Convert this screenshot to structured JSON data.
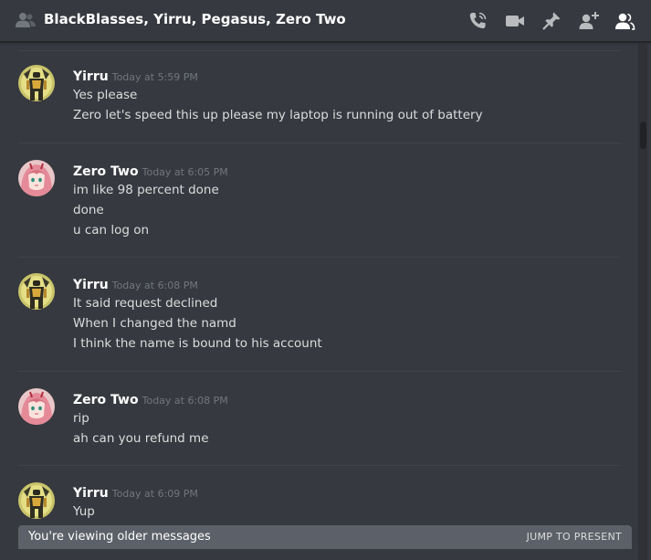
{
  "header": {
    "title": "BlackBlasses, Yirru, Pegasus, Zero Two",
    "icons": [
      "group-dm-icon",
      "call-icon",
      "video-icon",
      "pin-icon",
      "add-friend-icon",
      "member-list-icon"
    ]
  },
  "messages": [
    {
      "author": "Yirru",
      "timestamp": "Today at 5:59 PM",
      "avatar": "yellow-armored-figure",
      "lines": [
        "Yes please",
        "Zero let's speed this up please my laptop is running out of battery"
      ]
    },
    {
      "author": "Zero Two",
      "timestamp": "Today at 6:05 PM",
      "avatar": "pink-haired-girl",
      "lines": [
        "im like 98 percent done",
        "done",
        "u can log on"
      ]
    },
    {
      "author": "Yirru",
      "timestamp": "Today at 6:08 PM",
      "avatar": "yellow-armored-figure",
      "lines": [
        "It said request declined",
        "When I changed the namd",
        "I think the name is bound to his account"
      ]
    },
    {
      "author": "Zero Two",
      "timestamp": "Today at 6:08 PM",
      "avatar": "pink-haired-girl",
      "lines": [
        "rip",
        "ah can you refund me"
      ]
    },
    {
      "author": "Yirru",
      "timestamp": "Today at 6:09 PM",
      "avatar": "yellow-armored-figure",
      "lines": [
        "Yup"
      ]
    }
  ],
  "older_bar": {
    "label": "You're viewing older messages",
    "jump_label": "JUMP TO PRESENT"
  },
  "colors": {
    "background": "#36393f",
    "header_text": "#ffffff",
    "timestamp": "#72767d",
    "message_text": "#dcddde",
    "older_bar": "#5b6069"
  }
}
